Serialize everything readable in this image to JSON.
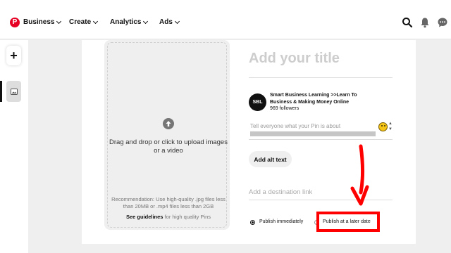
{
  "nav": {
    "logo_letter": "P",
    "items": [
      {
        "label": "Business"
      },
      {
        "label": "Create"
      },
      {
        "label": "Analytics"
      },
      {
        "label": "Ads"
      }
    ],
    "icons": [
      "search-icon",
      "bell-icon",
      "messages-icon"
    ]
  },
  "leftrail": {
    "add_label": "+",
    "draft_icon": "image-icon"
  },
  "upload": {
    "icon": "arrow-up-icon",
    "drag_text": "Drag and drop or click to upload images or a video",
    "recommendation": "Recommendation: Use high-quality .jpg files less than 20MB or .mp4 files less than 2GB",
    "guidelines_link": "See guidelines",
    "guidelines_rest": " for high quality Pins"
  },
  "form": {
    "title_placeholder": "Add your title",
    "account": {
      "avatar_text": "SBL",
      "name": "Smart Business Learning >>Learn To Business & Making Money Online",
      "followers": "969 followers"
    },
    "description_placeholder": "Tell everyone what your Pin is about",
    "alt_button": "Add alt text",
    "destination_placeholder": "Add a destination link",
    "publish_options": [
      {
        "label": "Publish immediately",
        "selected": true
      },
      {
        "label": "Publish at a later date",
        "selected": false
      }
    ]
  },
  "colors": {
    "brand": "#e60023",
    "annotation": "#ff0000"
  }
}
